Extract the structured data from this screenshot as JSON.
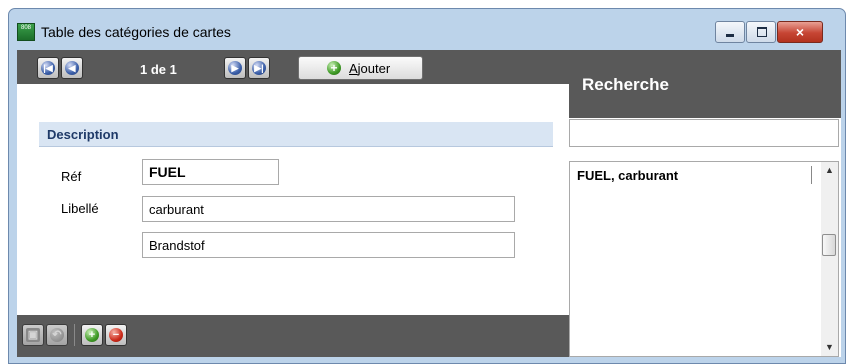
{
  "window": {
    "title": "Table des catégories de cartes",
    "app_icon_text": "808",
    "controls": {
      "minimize": "minimize",
      "maximize": "maximize",
      "close": "×"
    }
  },
  "toolbar": {
    "first_icon": "first-record-icon",
    "prev_icon": "previous-record-icon",
    "counter": "1 de 1",
    "next_icon": "next-record-icon",
    "last_icon": "last-record-icon",
    "add_label_accel": "A",
    "add_label_rest": "jouter"
  },
  "form": {
    "section_title": "Description",
    "ref_label": "Réf",
    "ref_value": "FUEL",
    "libelle_label": "Libellé",
    "libelle_value": "carburant",
    "libelle_alt_value": "Brandstof"
  },
  "search": {
    "title": "Recherche",
    "input_value": "",
    "results": [
      "FUEL, carburant"
    ]
  },
  "bottom": {
    "buttons": [
      "save-icon",
      "undo-icon",
      "add-icon",
      "delete-icon"
    ]
  },
  "colors": {
    "toolbar": "#595959",
    "window_frame": "#bcd3ea",
    "section_bar": "#d9e5f3",
    "close_button": "#c64534"
  }
}
